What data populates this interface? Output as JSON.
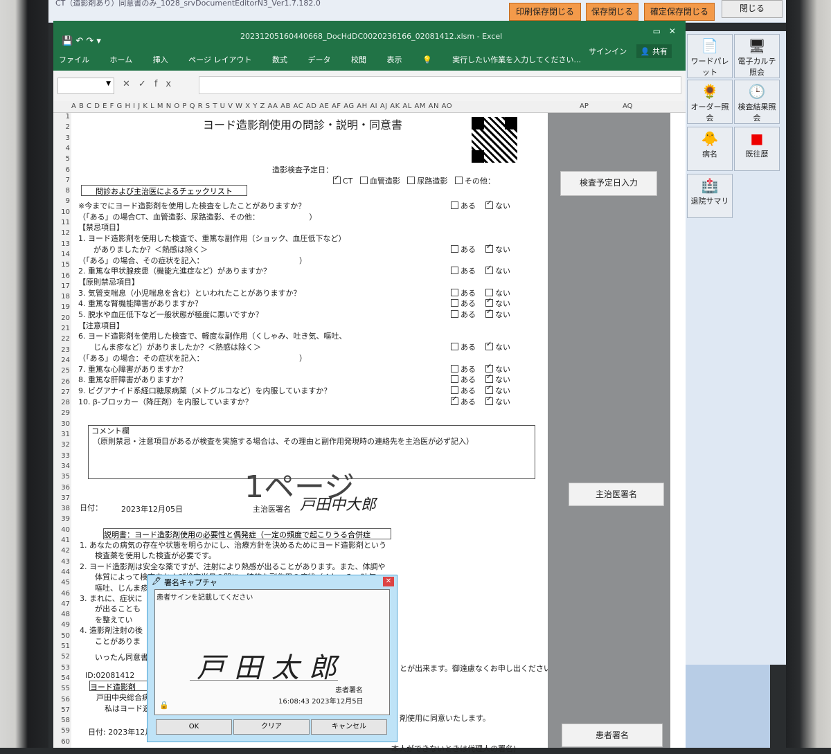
{
  "app_bar": {
    "title": "CT（造影剤あり）同意書のみ_1028_srvDocumentEditorN3_Ver1.7.182.0",
    "buttons": [
      "印刷保存閉じる",
      "保存閉じる",
      "確定保存閉じる"
    ],
    "close_label": "閉じる"
  },
  "excel": {
    "filename": "20231205160440668_DocHdDC0020236166_02081412.xlsm - Excel",
    "tabs": [
      "ファイル",
      "ホーム",
      "挿入",
      "ページ レイアウト",
      "数式",
      "データ",
      "校閲",
      "表示"
    ],
    "tell_me": "実行したい作業を入力してください...",
    "signin": "サインイン",
    "share": "共有",
    "fx": "fx",
    "column_headers": "A B C D E F G H I J K L M N O P Q R S T U V W X Y Z AA AB AC AD AE AF AG AH AI AJ AK AL AM AN AO",
    "col_ap": "AP",
    "col_aq": "AQ",
    "row_numbers": [
      "1",
      "2",
      "3",
      "4",
      "5",
      "6",
      "7",
      "8",
      "9",
      "10",
      "11",
      "12",
      "13",
      "14",
      "15",
      "16",
      "17",
      "18",
      "19",
      "20",
      "21",
      "22",
      "23",
      "24",
      "25",
      "26",
      "27",
      "28",
      "29",
      "30",
      "31",
      "32",
      "33",
      "34",
      "35",
      "36",
      "37",
      "38",
      "39",
      "40",
      "41",
      "42",
      "43",
      "44",
      "45",
      "46",
      "47",
      "48",
      "49",
      "50",
      "51",
      "52",
      "53",
      "54",
      "55",
      "56",
      "57",
      "58",
      "59",
      "60"
    ]
  },
  "form": {
    "title": "ヨード造影剤使用の問診・説明・同意書",
    "exam_date_label": "造影検査予定日：",
    "exam_types": [
      {
        "label": "CT",
        "checked": true
      },
      {
        "label": "血管造影",
        "checked": false
      },
      {
        "label": "尿路造影",
        "checked": false
      },
      {
        "label": "その他：",
        "checked": false
      }
    ],
    "checklist_header": "問診および主治医によるチェックリスト",
    "questions": [
      {
        "text": "※今までにヨード造影剤を使用した検査をしたことがありますか？",
        "yes": false,
        "no": true
      },
      {
        "text": "（「ある」の場合CT、血管造影、尿路造影、その他：　　　　　　　）",
        "yes": null,
        "no": null
      },
      {
        "text": "【禁忌項目】",
        "yes": null,
        "no": null
      },
      {
        "text": "1. ヨード造影剤を使用した検査で、重篤な副作用（ショック、血圧低下など）",
        "yes": null,
        "no": null
      },
      {
        "text": "　　がありましたか？＜熱感は除く＞",
        "yes": false,
        "no": true
      },
      {
        "text": "（「ある」の場合、その症状を記入：　　　　　　　　　　　　　）",
        "yes": null,
        "no": null
      },
      {
        "text": "2. 重篤な甲状腺疾患（機能亢進症など）がありますか？",
        "yes": false,
        "no": true
      },
      {
        "text": "【原則禁忌項目】",
        "yes": null,
        "no": null
      },
      {
        "text": "3. 気管支喘息（小児喘息を含む）といわれたことがありますか？",
        "yes": false,
        "no": false
      },
      {
        "text": "4. 重篤な腎機能障害がありますか？",
        "yes": false,
        "no": true
      },
      {
        "text": "5. 脱水や血圧低下など一般状態が極度に悪いですか？",
        "yes": false,
        "no": true
      },
      {
        "text": "【注意項目】",
        "yes": null,
        "no": null
      },
      {
        "text": "6. ヨード造影剤を使用した検査で、軽度な副作用（くしゃみ、吐き気、嘔吐、",
        "yes": null,
        "no": null
      },
      {
        "text": "　　じんま疹など）がありましたか？＜熱感は除く＞",
        "yes": false,
        "no": true
      },
      {
        "text": "（「ある」の場合：その症状を記入：　　　　　　　　　　　　　）",
        "yes": null,
        "no": null
      },
      {
        "text": "7. 重篤な心障害がありますか？",
        "yes": false,
        "no": true
      },
      {
        "text": "8. 重篤な肝障害がありますか？",
        "yes": false,
        "no": true
      },
      {
        "text": "9. ビグアナイド系経口糖尿病薬（メトグルコなど）を内服していますか？",
        "yes": false,
        "no": true
      },
      {
        "text": "10. β-ブロッカー（降圧剤）を内服していますか？",
        "yes": true,
        "no": true
      }
    ],
    "yes_label": "ある",
    "no_label": "ない",
    "comment_label": "コメント欄",
    "comment_note": "（原則禁忌・注意項目があるが検査を実施する場合は、その理由と副作用発現時の連絡先を主治医が必ず記入）",
    "page_watermark": "1ページ",
    "date_label": "日付：",
    "date_value": "2023年12月05日",
    "doctor_sig_label": "主治医署名",
    "doctor_signature": "戸田中大郎",
    "explanation_header": "説明書：ヨード造影剤使用の必要性と偶発症（一定の頻度で起こりうる合併症",
    "explanation_lines": [
      "1. あなたの病気の存在や状態を明らかにし、治療方針を決めるためにヨード造影剤という",
      "　　検査薬を使用した検査が必要です。",
      "2. ヨード造影剤は安全な薬ですが、注射により熱感が出ることがあります。また、体調や",
      "　　体質によって検査中および検査当日の間に一時的な副作用の症状（くしゃみ、吐気、",
      "　　嘔吐、じんま疹など）が出ることがあります。(100人中3～4人)。",
      "3. まれに、症状に",
      "　　が出ることも",
      "　　を整えてい",
      "4. 造影剤注射の後",
      "　　ことがありま"
    ],
    "withdraw_line": "いったん同意書",
    "withdraw_tail": "とが出来ます。御遠慮なくお申し出ください。",
    "patient_id": "ID:02081412",
    "consent_header": "ヨード造影剤",
    "hospital_line": "戸田中央総合病",
    "consent_line": "私はヨード造",
    "consent_tail": "剤使用に同意いたします。",
    "bottom_date_label": "日付: 2023年12月",
    "proxy_note": "本人ができないときは代理人の署名)"
  },
  "panel_buttons": {
    "exam_date_input": "検査予定日入力",
    "doctor_signature": "主治医署名",
    "patient_signature": "患者署名"
  },
  "right_toolbar": [
    {
      "label": "ワードパレット",
      "icon": "document-icon"
    },
    {
      "label": "電子カルテ照会",
      "icon": "monitor-icon"
    },
    {
      "label": "オーダー照会",
      "icon": "sunflower-icon"
    },
    {
      "label": "検査結果照会",
      "icon": "clock-icon"
    },
    {
      "label": "病名",
      "icon": "character-icon"
    },
    {
      "label": "既往歴",
      "icon": "red-square-icon"
    },
    {
      "label": "退院サマリ",
      "icon": "hospital-icon"
    }
  ],
  "signature_dialog": {
    "title": "署名キャプチャ",
    "instruction": "患者サインを記載してください",
    "signature": "戸田太郎",
    "sig_label": "患者署名",
    "timestamp": "16:08:43 2023年12月5日",
    "buttons": [
      "OK",
      "クリア",
      "キャンセル"
    ]
  }
}
